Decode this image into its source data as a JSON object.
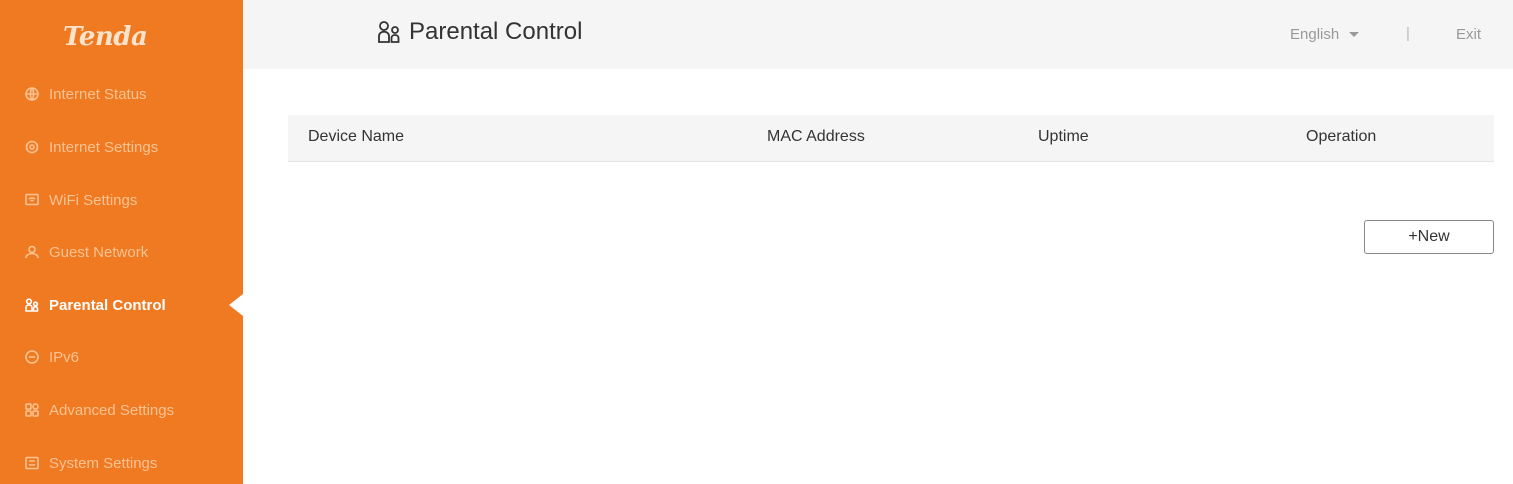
{
  "brand": {
    "logo_text": "Tenda",
    "accent": "#f07a22"
  },
  "sidebar": {
    "items": [
      {
        "label": "Internet Status",
        "icon": "globe-icon",
        "active": false
      },
      {
        "label": "Internet Settings",
        "icon": "settings-gear-icon",
        "active": false
      },
      {
        "label": "WiFi Settings",
        "icon": "wifi-box-icon",
        "active": false
      },
      {
        "label": "Guest Network",
        "icon": "guest-user-icon",
        "active": false
      },
      {
        "label": "Parental Control",
        "icon": "parental-users-icon",
        "active": true
      },
      {
        "label": "IPv6",
        "icon": "ipv6-icon",
        "active": false
      },
      {
        "label": "Advanced Settings",
        "icon": "grid-icon",
        "active": false
      },
      {
        "label": "System Settings",
        "icon": "system-panel-icon",
        "active": false
      }
    ]
  },
  "header": {
    "title": "Parental Control",
    "language": "English",
    "separator": "|",
    "exit": "Exit"
  },
  "table": {
    "columns": [
      "Device Name",
      "MAC Address",
      "Uptime",
      "Operation"
    ],
    "rows": []
  },
  "actions": {
    "new_label": "+New"
  }
}
